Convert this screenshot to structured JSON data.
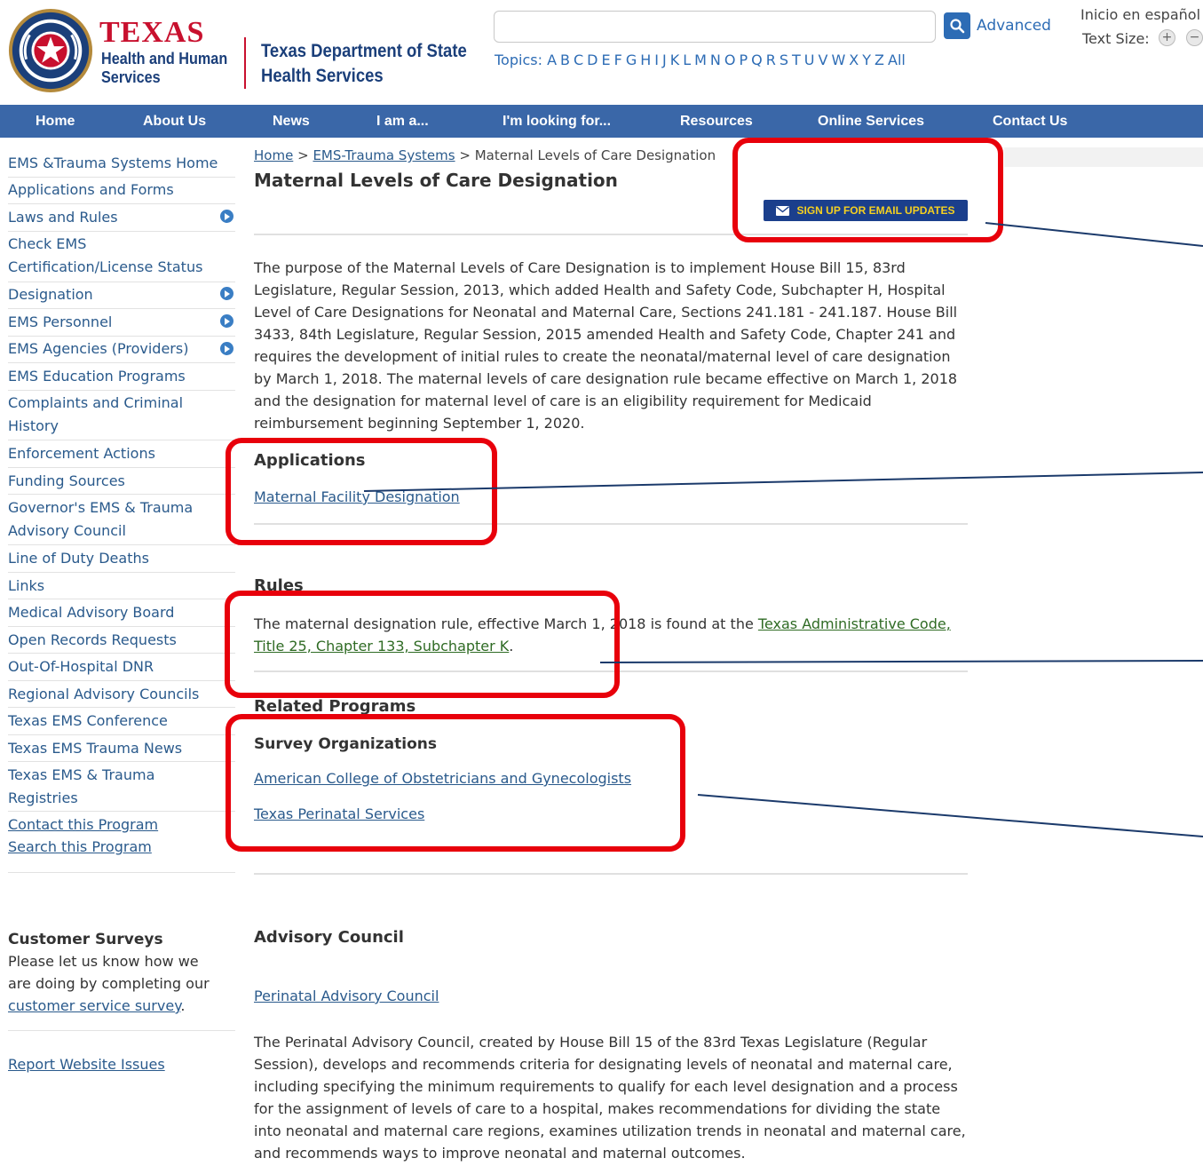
{
  "header": {
    "logo_texas": "TEXAS",
    "logo_hhs_line1": "Health and Human",
    "logo_hhs_line2": "Services",
    "logo_dshs_line1": "Texas Department of State",
    "logo_dshs_line2": "Health Services",
    "search_placeholder": "",
    "advanced_label": "Advanced",
    "topics_label": "Topics:",
    "topics_letters": [
      "A",
      "B",
      "C",
      "D",
      "E",
      "F",
      "G",
      "H",
      "I",
      "J",
      "K",
      "L",
      "M",
      "N",
      "O",
      "P",
      "Q",
      "R",
      "S",
      "T",
      "U",
      "V",
      "W",
      "X",
      "Y",
      "Z",
      "All"
    ],
    "spanish_label": "Inicio en español",
    "text_size_label": "Text Size:",
    "text_size_plus": "+",
    "text_size_minus": "−"
  },
  "nav": {
    "items": [
      "Home",
      "About Us",
      "News",
      "I am a...",
      "I'm looking for...",
      "Resources",
      "Online Services",
      "Contact Us"
    ]
  },
  "sidebar": {
    "items": [
      "EMS &Trauma Systems Home",
      "Applications and Forms",
      "Laws and Rules",
      "Check EMS Certification/License Status",
      "Designation",
      "EMS Personnel",
      "EMS Agencies (Providers)",
      "EMS Education Programs",
      "Complaints and Criminal History",
      "Enforcement Actions",
      "Funding Sources",
      "Governor's EMS & Trauma Advisory Council",
      "Line of Duty Deaths",
      "Links",
      "Medical Advisory Board",
      "Open Records Requests",
      "Out-Of-Hospital DNR",
      "Regional Advisory Councils",
      "Texas EMS Conference",
      "Texas EMS Trauma News",
      "Texas EMS & Trauma Registries"
    ],
    "contact_link": "Contact this Program",
    "search_link": "Search this Program",
    "surveys_title": "Customer Surveys",
    "surveys_text": "Please let us know how we are doing by completing our",
    "surveys_link": "customer service survey",
    "surveys_period": ".",
    "report_link": "Report Website Issues"
  },
  "breadcrumb": {
    "home": "Home",
    "sep1": ">",
    "section": "EMS-Trauma Systems",
    "sep2": ">",
    "current": "Maternal Levels of Care Designation"
  },
  "main": {
    "title": "Maternal Levels of Care Designation",
    "email_button": "SIGN UP FOR EMAIL UPDATES",
    "intro": "The purpose of the Maternal Levels of Care Designation is to implement House Bill 15, 83rd Legislature, Regular Session, 2013, which added Health and Safety Code, Subchapter H, Hospital Level of Care Designations for Neonatal and Maternal Care, Sections 241.181 - 241.187. House Bill 3433, 84th Legislature, Regular Session, 2015 amended Health and Safety Code, Chapter 241 and requires the development of initial rules to create the neonatal/maternal level of care designation by March 1, 2018. The maternal levels of care designation rule became effective on March 1, 2018 and the designation for maternal level of care is an eligibility requirement for Medicaid reimbursement beginning September 1, 2020.",
    "applications_heading": "Applications",
    "applications_link": "Maternal Facility Designation",
    "rules_heading": "Rules",
    "rules_text": "The maternal designation rule, effective March 1, 2018 is found at the",
    "rules_link": "Texas Administrative Code, Title 25, Chapter 133, Subchapter K",
    "rules_period": ".",
    "related_heading": "Related Programs",
    "survey_heading": "Survey Organizations",
    "survey_link1": "American College of Obstetricians and Gynecologists",
    "survey_link2": "Texas Perinatal Services",
    "advisory_heading": "Advisory Council",
    "advisory_link": "Perinatal Advisory Council",
    "advisory_text": "The Perinatal Advisory Council, created by House Bill 15 of the 83rd Texas Legislature (Regular Session), develops and recommends criteria for designating levels of neonatal and maternal care, including specifying the minimum requirements to qualify for each level designation and a process for the assignment of levels of care to a hospital, makes recommendations for dividing the state into neonatal and maternal care regions, examines utilization trends in neonatal and maternal care, and recommends ways to improve neonatal and maternal outcomes."
  },
  "colors": {
    "nav_bg": "#3a67a8",
    "link": "#2a5a8c",
    "annotation": "#e8000b",
    "email_button_bg": "#1b3f8c",
    "email_button_text": "#f5d020"
  }
}
